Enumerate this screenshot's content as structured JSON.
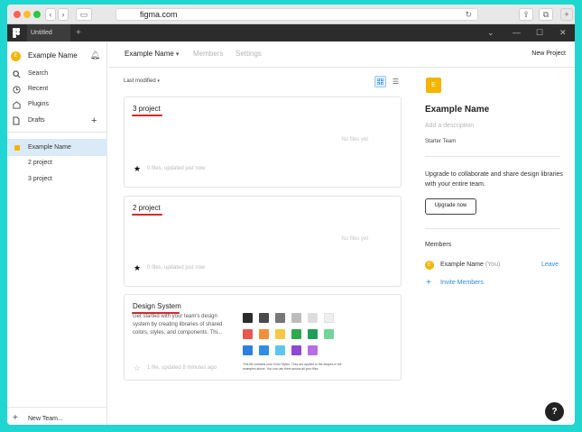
{
  "browser": {
    "url": "figma.com",
    "traffic_colors": [
      "#fc5f57",
      "#fdbc2e",
      "#28c840"
    ]
  },
  "figma_bar": {
    "tab_title": "Untitled",
    "add_tab": "+",
    "chevron": "⌄",
    "minimize": "—",
    "maximize": "☐",
    "close": "✕"
  },
  "sidebar": {
    "team_name": "Example Name",
    "team_initial": "E",
    "nav": [
      {
        "label": "Search",
        "icon": "search-icon"
      },
      {
        "label": "Recent",
        "icon": "clock-icon"
      },
      {
        "label": "Plugins",
        "icon": "plugins-icon"
      },
      {
        "label": "Drafts",
        "icon": "file-icon"
      }
    ],
    "drafts_add": "+",
    "projects": [
      {
        "label": "Example Name",
        "active": true
      },
      {
        "label": "2 project",
        "active": false
      },
      {
        "label": "3 project",
        "active": false
      }
    ],
    "new_team": "New Team..."
  },
  "header": {
    "title": "Example Name",
    "tabs": [
      "Members",
      "Settings"
    ],
    "new_project": "New Project"
  },
  "main": {
    "sort_label": "Last modified",
    "cards": [
      {
        "title": "3 project",
        "empty_text": "No files yet",
        "meta": "0 files, updated just now"
      },
      {
        "title": "2 project",
        "empty_text": "No files yet",
        "meta": "0 files, updated just now"
      }
    ],
    "design_system": {
      "title": "Design System",
      "description": "Get started with your team's design system by creating libraries of shared colors, styles, and components. Thi...",
      "meta": "1 file, updated 8 minutes ago",
      "swatches": [
        "#2b2b2b",
        "#4a4a4a",
        "#777777",
        "#bdbdbd",
        "#dddddd",
        "#efefef",
        "#e8574f",
        "#f0913a",
        "#f6c645",
        "#2fa84f",
        "#1e9e5a",
        "#73d49a",
        "#2d7fe0",
        "#2e8ee4",
        "#5ec6ee",
        "#8e48d6",
        "#b86ee3"
      ],
      "note": "This file contains your Color Styles. They are applied to the shapes in the examples above. You can use them across all your files."
    }
  },
  "right_panel": {
    "initial": "E",
    "name": "Example Name",
    "add_description": "Add a description",
    "plan": "Starter Team",
    "upgrade_text": "Upgrade to collaborate and share design libraries with your entire team.",
    "upgrade_button": "Upgrade now",
    "members_title": "Members",
    "member_name": "Example Name",
    "member_you": "(You)",
    "member_initial": "E",
    "leave": "Leave",
    "invite": "Invite Members"
  },
  "help": "?"
}
